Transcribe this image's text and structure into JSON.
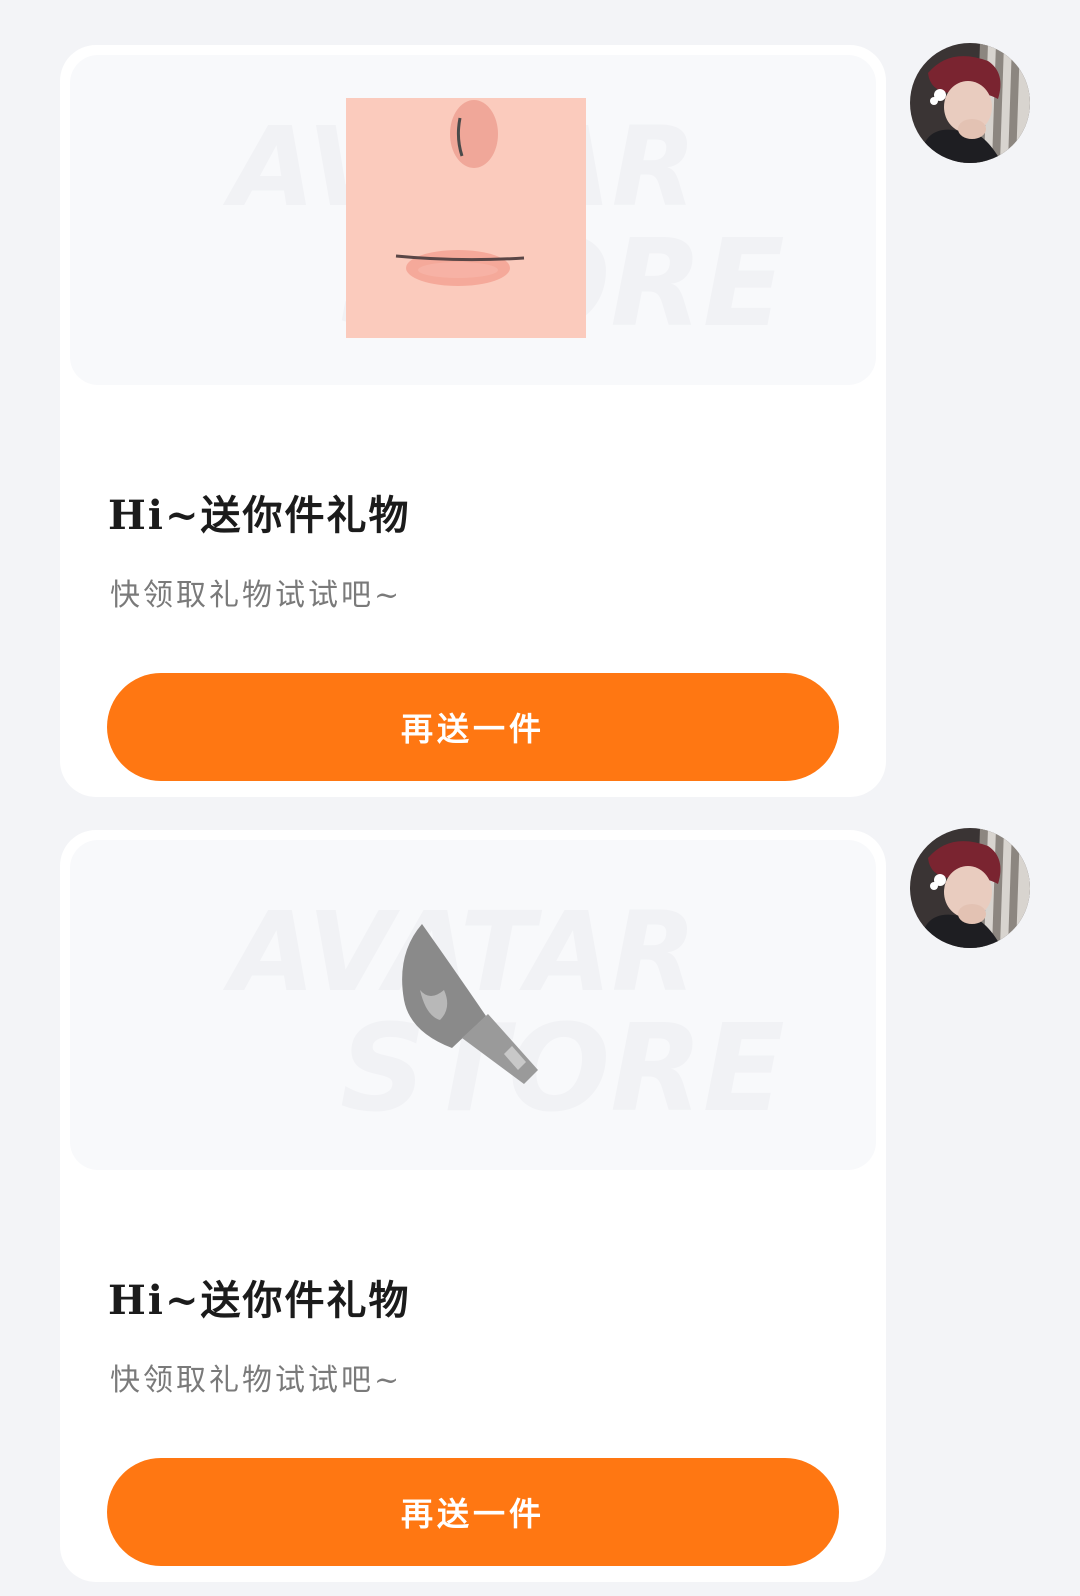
{
  "colors": {
    "accent": "#ff7712",
    "page_background": "#f3f4f7",
    "card_background": "#ffffff"
  },
  "watermark": {
    "line1": "AVATAR",
    "line2": "STORE"
  },
  "messages": [
    {
      "item_icon": "face-makeup-icon",
      "title": "Hi~送你件礼物",
      "subtitle": "快领取礼物试试吧~",
      "button_label": "再送一件"
    },
    {
      "item_icon": "cleaver-knife-icon",
      "title": "Hi~送你件礼物",
      "subtitle": "快领取礼物试试吧~",
      "button_label": "再送一件"
    }
  ]
}
